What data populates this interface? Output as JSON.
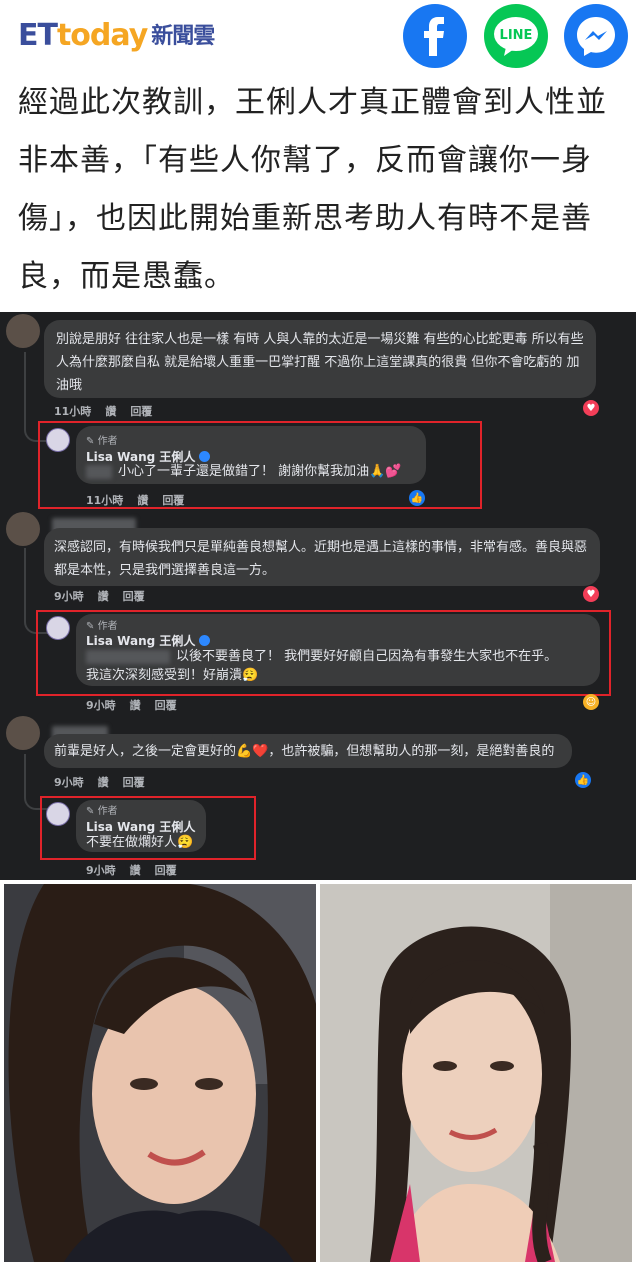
{
  "header": {
    "logo_et": "ET",
    "logo_today": "today",
    "logo_sub": "新聞雲",
    "share_icons": [
      "facebook-icon",
      "line-icon",
      "messenger-icon"
    ],
    "line_label": "LINE"
  },
  "article": {
    "paragraph": "經過此次教訓，王俐人才真正體會到人性並非本善，「有些人你幫了，反而會讓你一身傷」，也因此開始重新思考助人有時不是善良，而是愚蠢。"
  },
  "screenshot": {
    "comments": [
      {
        "text": "別說是朋好 往往家人也是一樣 有時 人與人靠的太近是一場災難 有些的心比蛇更毒 所以有些人為什麼那麼自私 就是給壞人重重一巴掌打醒 不過你上這堂課真的很貴 但你不會吃虧的 加油哦",
        "time": "11小時",
        "like": "讚",
        "reply": "回覆",
        "reply_item": {
          "author_tag": "作者",
          "author_name": "Lisa Wang 王俐人",
          "text": "小心了一輩子還是做錯了！ 謝謝你幫我加油🙏💕",
          "time": "11小時",
          "like": "讚",
          "reply": "回覆"
        }
      },
      {
        "text": "深感認同，有時候我們只是單純善良想幫人。近期也是遇上這樣的事情，非常有感。善良與惡都是本性，只是我們選擇善良這一方。",
        "time": "9小時",
        "like": "讚",
        "reply": "回覆",
        "reply_item": {
          "author_tag": "作者",
          "author_name": "Lisa Wang 王俐人",
          "text": "以後不要善良了！ 我們要好好顧自己因為有事發生大家也不在乎。",
          "text2": "我這次深刻感受到！好崩潰😮‍💨",
          "time": "9小時",
          "like": "讚",
          "reply": "回覆"
        }
      },
      {
        "text": "前輩是好人，之後一定會更好的💪❤️，也許被騙，但想幫助人的那一刻，是絕對善良的",
        "time": "9小時",
        "like": "讚",
        "reply": "回覆",
        "reply_item": {
          "author_tag": "作者",
          "author_name": "Lisa Wang 王俐人",
          "text": "不要在做爛好人😮‍💨",
          "time": "9小時",
          "like": "讚",
          "reply": "回覆"
        }
      }
    ]
  },
  "colors": {
    "brand_blue": "#3a4e9c",
    "brand_orange": "#f5a623",
    "facebook": "#1877f2",
    "line": "#06c755",
    "highlight_red": "#e0232a"
  }
}
